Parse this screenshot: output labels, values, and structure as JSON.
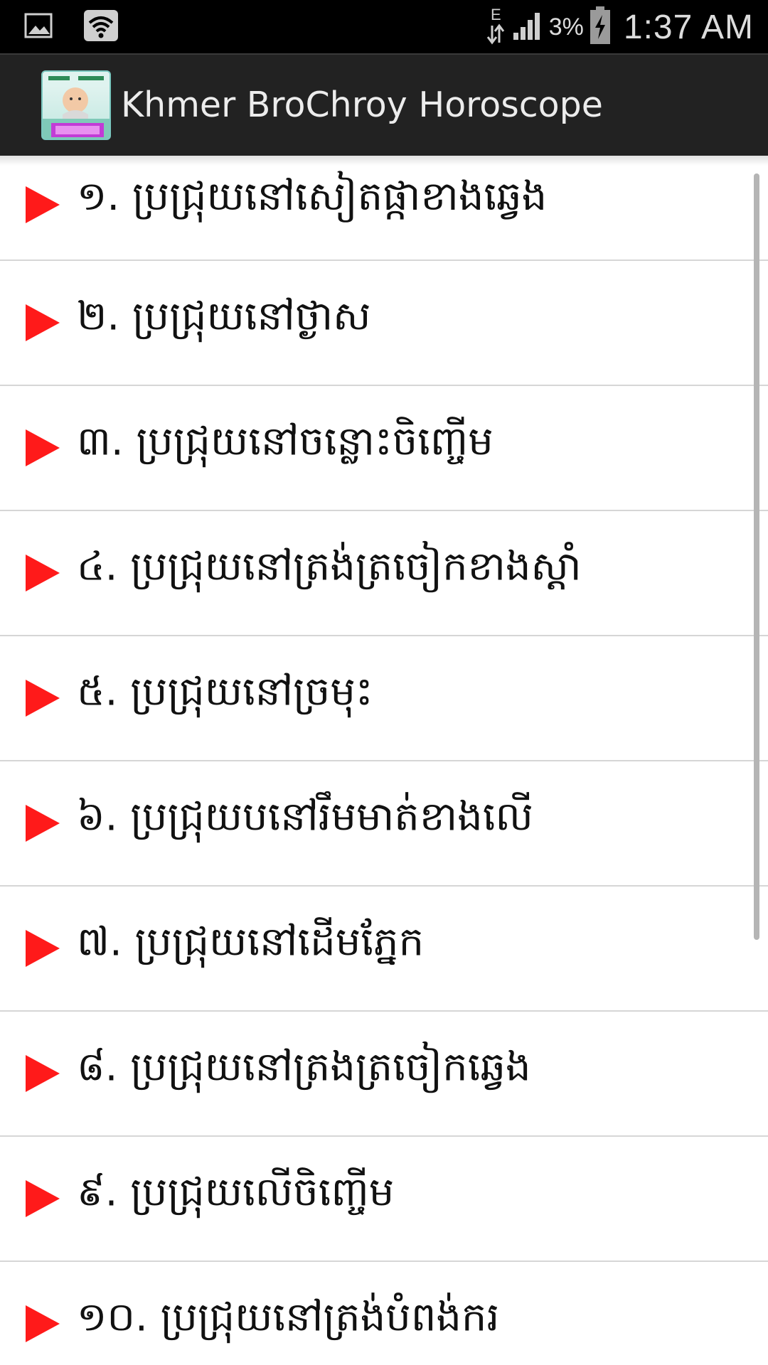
{
  "status_bar": {
    "network_type": "E",
    "battery_percent": "3%",
    "time": "1:37 AM",
    "icons": [
      "image-icon",
      "wifi-icon",
      "data-arrows-icon",
      "signal-icon",
      "battery-charging-icon"
    ]
  },
  "action_bar": {
    "title": "Khmer BroChroy Horoscope",
    "icon": "app-logo-icon"
  },
  "list": {
    "items": [
      {
        "label": "១. ប្រជ្រុយនៅសៀតផ្កាខាងឆ្វេង"
      },
      {
        "label": "២. ប្រជ្រុយនៅថ្ងាស"
      },
      {
        "label": "៣. ប្រជ្រុយនៅចន្លោះចិញ្ចើម"
      },
      {
        "label": "៤. ប្រជ្រុយនៅត្រង់ត្រចៀកខាងស្តាំ"
      },
      {
        "label": "៥. ប្រជ្រុយនៅច្រមុះ"
      },
      {
        "label": "៦. ប្រជ្រុយបនៅរឹមមាត់ខាងលើ"
      },
      {
        "label": "៧. ប្រជ្រុយនៅដើមភ្នែក"
      },
      {
        "label": "៨. ប្រជ្រុយនៅត្រងត្រចៀកឆ្វេង"
      },
      {
        "label": "៩. ប្រជ្រុយលើចិញ្ចើម"
      },
      {
        "label": "១០. ប្រជ្រុយនៅត្រង់បំពង់ករ"
      }
    ]
  },
  "colors": {
    "arrow": "#ff1a1a",
    "action_bar": "#222222",
    "divider": "#d6d6d6"
  }
}
